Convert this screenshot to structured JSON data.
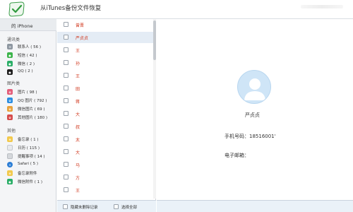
{
  "window": {
    "title": "从iTunes备份文件恢复"
  },
  "sidebar": {
    "device": "的 iPhone",
    "groups": [
      {
        "label": "通讯类",
        "items": [
          {
            "label": "联系人 ( 56 )",
            "icon": "contacts-icon",
            "color": "#8d96a0"
          },
          {
            "label": "短信 ( 42 )",
            "icon": "sms-icon",
            "color": "#3cb44b"
          },
          {
            "label": "微信 ( 2 )",
            "icon": "wechat-icon",
            "color": "#2aae67"
          },
          {
            "label": "QQ ( 2 )",
            "icon": "qq-icon",
            "color": "#1f1f1f"
          }
        ]
      },
      {
        "label": "图片类",
        "items": [
          {
            "label": "图片 ( 98 )",
            "icon": "photos-icon",
            "color": "#e35d7a"
          },
          {
            "label": "QQ 图片 ( 792 )",
            "icon": "qq-photos-icon",
            "color": "#2b8de0"
          },
          {
            "label": "微信图片 ( 69 )",
            "icon": "wechat-photos-icon",
            "color": "#e8a23c"
          },
          {
            "label": "其他图片 ( 180 )",
            "icon": "other-photos-icon",
            "color": "#d64c4c"
          }
        ]
      },
      {
        "label": "其他",
        "items": [
          {
            "label": "备忘录 ( 1 )",
            "icon": "notes-icon",
            "color": "#f2c94c"
          },
          {
            "label": "日历 ( 115 )",
            "icon": "calendar-icon",
            "color": "#e8eaed"
          },
          {
            "label": "提醒事项 ( 14 )",
            "icon": "reminders-icon",
            "color": "#d5d8dc"
          },
          {
            "label": "Safari ( 5 )",
            "icon": "safari-icon",
            "color": "#2e7fd6"
          },
          {
            "label": "备忘录附件",
            "icon": "notes-attachment-icon",
            "color": "#f2c94c"
          },
          {
            "label": "微信附件 ( 1 )",
            "icon": "wechat-attachment-icon",
            "color": "#2aae67"
          }
        ]
      }
    ]
  },
  "list": {
    "contacts": [
      "曾晋",
      "严贞贞",
      "王",
      "孙",
      "王",
      "田",
      "蒋",
      "大",
      "叔",
      "太",
      "大",
      "马",
      "方",
      "王"
    ],
    "selected_index": 1,
    "bottom": {
      "hide_deleted": "隐藏未删除记录",
      "select_all": "选择全部"
    }
  },
  "detail": {
    "name": "严贞贞",
    "phone": "手机号码：18516001'",
    "email": "电子邮箱："
  },
  "colors": {
    "accent": "#d0361c",
    "selection": "#e4ecf5",
    "brand": "#2aae67"
  }
}
